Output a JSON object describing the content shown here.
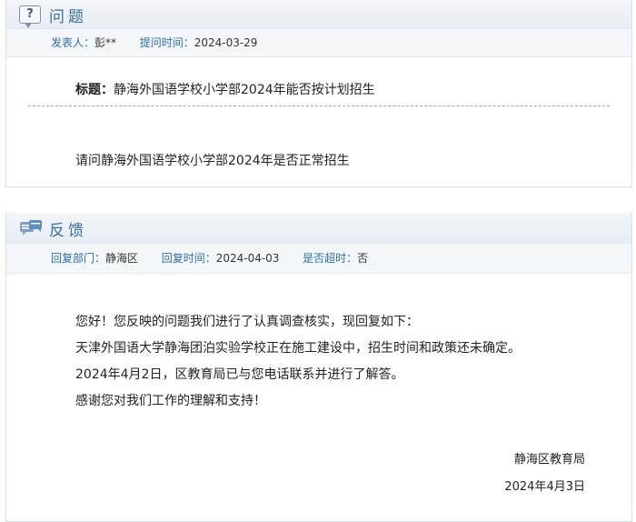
{
  "question": {
    "header": "问题",
    "icon": "question-bubble-icon",
    "meta": {
      "poster_label": "发表人：",
      "poster_value": "彭**",
      "time_label": "提问时间：",
      "time_value": "2024-03-29"
    },
    "title_label": "标题：",
    "title_value": "静海外国语学校小学部2024年能否按计划招生",
    "content": "请问静海外国语学校小学部2024年是否正常招生"
  },
  "feedback": {
    "header": "反馈",
    "icon": "chat-bubbles-icon",
    "meta": {
      "dept_label": "回复部门：",
      "dept_value": "静海区",
      "time_label": "回复时间：",
      "time_value": "2024-04-03",
      "overdue_label": "是否超时：",
      "overdue_value": "否"
    },
    "paragraphs": [
      "您好！您反映的问题我们进行了认真调查核实，现回复如下：",
      "天津外国语大学静海团泊实验学校正在施工建设中，招生时间和政策还未确定。",
      "2024年4月2日，区教育局已与您电话联系并进行了解答。",
      "感谢您对我们工作的理解和支持！"
    ],
    "signature_org": "静海区教育局",
    "signature_date": "2024年4月3日"
  },
  "colors": {
    "accent": "#2f6ea8",
    "header_bg": "#e7edf3",
    "border": "#d6dee6"
  }
}
